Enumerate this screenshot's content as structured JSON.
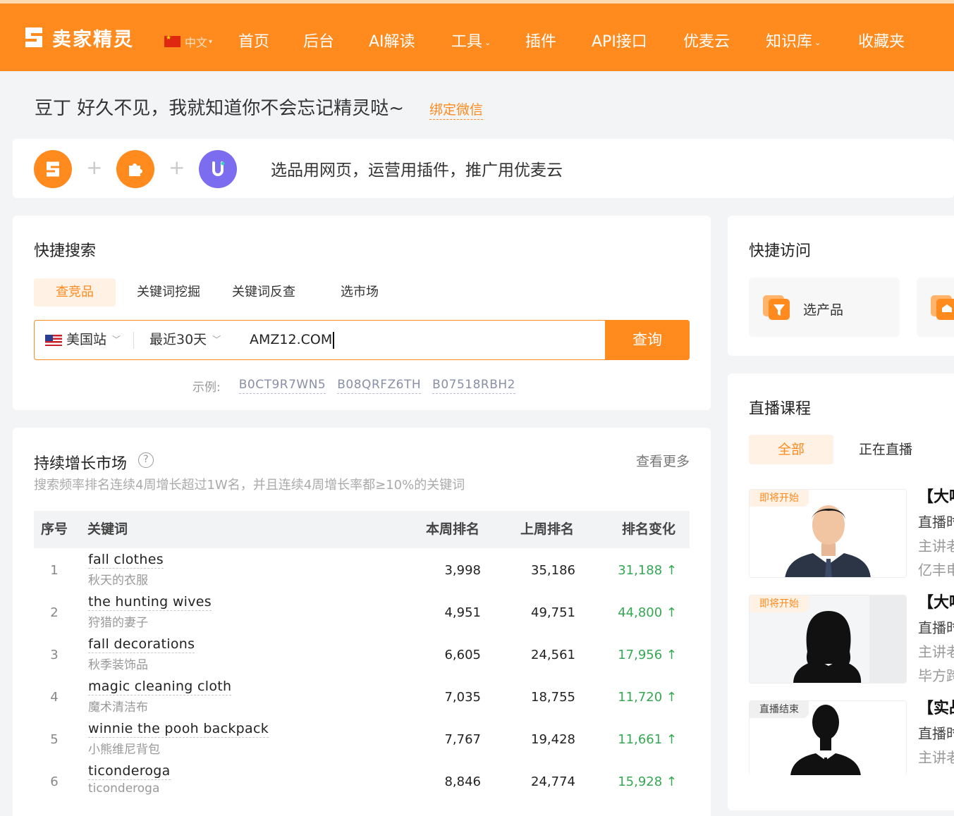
{
  "brand": {
    "name": "卖家精灵"
  },
  "lang": {
    "label": "中文"
  },
  "nav": [
    {
      "label": "首页",
      "dropdown": false
    },
    {
      "label": "后台",
      "dropdown": false
    },
    {
      "label": "AI解读",
      "dropdown": false
    },
    {
      "label": "工具",
      "dropdown": true
    },
    {
      "label": "插件",
      "dropdown": false
    },
    {
      "label": "API接口",
      "dropdown": false
    },
    {
      "label": "优麦云",
      "dropdown": false
    },
    {
      "label": "知识库",
      "dropdown": true
    },
    {
      "label": "收藏夹",
      "dropdown": false
    }
  ],
  "greeting": {
    "text": "豆丁 好久不见，我就知道你不会忘记精灵哒~",
    "bind_wechat": "绑定微信"
  },
  "promo": {
    "text": "选品用网页，运营用插件，推广用优麦云"
  },
  "quick_search": {
    "title": "快捷搜索",
    "tabs": [
      "查竞品",
      "关键词挖掘",
      "关键词反查",
      "选市场"
    ],
    "active_tab": "查竞品",
    "marketplace": "美国站",
    "period": "最近30天",
    "query_value": "AMZ12.COM",
    "submit_label": "查询",
    "examples_label": "示例:",
    "examples": [
      "B0CT9R7WN5",
      "B08QRFZ6TH",
      "B07518RBH2"
    ]
  },
  "growth_market": {
    "title": "持续增长市场",
    "help": "?",
    "more": "查看更多",
    "subtitle": "搜索频率排名连续4周增长超过1W名，并且连续4周增长率都≥10%的关键词",
    "columns": {
      "idx": "序号",
      "keyword": "关键词",
      "this_week": "本周排名",
      "last_week": "上周排名",
      "change": "排名变化"
    },
    "rows": [
      {
        "idx": "1",
        "en": "fall clothes",
        "cn": "秋天的衣服",
        "this_week": "3,998",
        "last_week": "35,186",
        "change": "31,188 ↑"
      },
      {
        "idx": "2",
        "en": "the hunting wives",
        "cn": "狩猎的妻子",
        "this_week": "4,951",
        "last_week": "49,751",
        "change": "44,800 ↑"
      },
      {
        "idx": "3",
        "en": "fall decorations",
        "cn": "秋季装饰品",
        "this_week": "6,605",
        "last_week": "24,561",
        "change": "17,956 ↑"
      },
      {
        "idx": "4",
        "en": "magic cleaning cloth",
        "cn": "魔术清洁布",
        "this_week": "7,035",
        "last_week": "18,755",
        "change": "11,720 ↑"
      },
      {
        "idx": "5",
        "en": "winnie the pooh backpack",
        "cn": "小熊维尼背包",
        "this_week": "7,767",
        "last_week": "19,428",
        "change": "11,661 ↑"
      },
      {
        "idx": "6",
        "en": "ticonderoga",
        "cn": "ticonderoga",
        "this_week": "8,846",
        "last_week": "24,774",
        "change": "15,928 ↑"
      }
    ]
  },
  "quick_access": {
    "title": "快捷访问",
    "items": [
      "选产品"
    ]
  },
  "live": {
    "title": "直播课程",
    "tabs": [
      "全部",
      "正在直播"
    ],
    "courses": [
      {
        "badge": "即将开始",
        "title": "【大啡",
        "line1": "直播时",
        "line2": "主讲老",
        "line3": "亿丰电"
      },
      {
        "badge": "即将开始",
        "title": "【大啡",
        "line1": "直播时",
        "line2": "主讲老",
        "line3": "毕方跨"
      },
      {
        "badge": "直播结束",
        "title": "【实战",
        "line1": "直播时",
        "line2": "主讲老"
      }
    ]
  },
  "colors": {
    "brand_orange": "#ff8a1e",
    "up_green": "#34a853"
  },
  "icons": [
    "logo-s-icon",
    "puzzle-icon",
    "youmai-u-icon",
    "filter-folder-icon",
    "help-circle-icon",
    "chevron-down-icon",
    "arrow-up-icon"
  ]
}
